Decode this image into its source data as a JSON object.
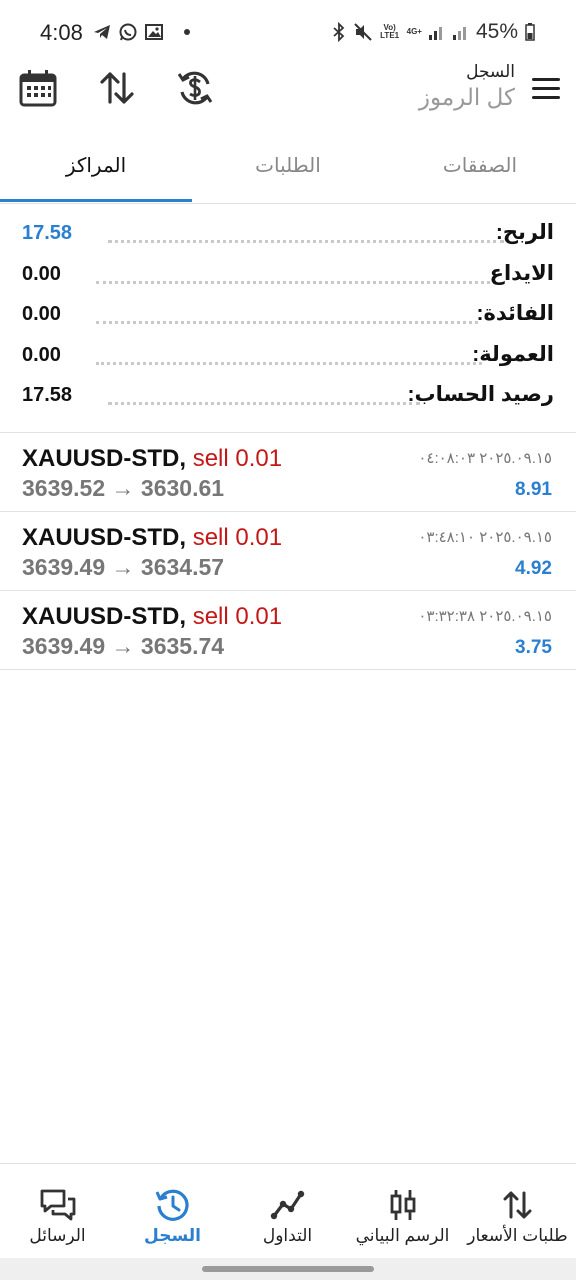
{
  "status_bar": {
    "time": "4:08",
    "battery": "45%",
    "network_label": "4G+",
    "volte_label": "Vo) LTE1"
  },
  "header": {
    "subtitle": "السجل",
    "title": "كل الرموز"
  },
  "tabs": [
    {
      "label": "الصفقات",
      "active": false
    },
    {
      "label": "الطلبات",
      "active": false
    },
    {
      "label": "المراكز",
      "active": true
    }
  ],
  "summary": [
    {
      "label": "الربح:",
      "value": "17.58",
      "highlight": true
    },
    {
      "label": "الايداع",
      "value": "0.00",
      "highlight": false
    },
    {
      "label": "الفائدة:",
      "value": "0.00",
      "highlight": false
    },
    {
      "label": "العمولة:",
      "value": "0.00",
      "highlight": false
    },
    {
      "label": "رصيد الحساب:",
      "value": "17.58",
      "highlight": false
    }
  ],
  "positions": [
    {
      "symbol": "XAUUSD-STD,",
      "side": "sell 0.01",
      "open_price": "3639.52",
      "arrow": "→",
      "close_price": "3630.61",
      "time": "٢٠٢٥.٠٩.١٥ ٠٤:٠٨:٠٣",
      "profit": "8.91"
    },
    {
      "symbol": "XAUUSD-STD,",
      "side": "sell 0.01",
      "open_price": "3639.49",
      "arrow": "→",
      "close_price": "3634.57",
      "time": "٢٠٢٥.٠٩.١٥ ٠٣:٤٨:١٠",
      "profit": "4.92"
    },
    {
      "symbol": "XAUUSD-STD,",
      "side": "sell 0.01",
      "open_price": "3639.49",
      "arrow": "→",
      "close_price": "3635.74",
      "time": "٢٠٢٥.٠٩.١٥ ٠٣:٣٢:٣٨",
      "profit": "3.75"
    }
  ],
  "bottom_nav": [
    {
      "label": "الرسائل",
      "icon": "messages-icon",
      "active": false
    },
    {
      "label": "السجل",
      "icon": "history-icon",
      "active": true
    },
    {
      "label": "التداول",
      "icon": "trade-icon",
      "active": false
    },
    {
      "label": "الرسم البياني",
      "icon": "chart-icon",
      "active": false
    },
    {
      "label": "طلبات الأسعار",
      "icon": "quotes-icon",
      "active": false
    }
  ],
  "colors": {
    "accent": "#2b7fd0",
    "sell": "#c41818",
    "muted": "#777777"
  }
}
